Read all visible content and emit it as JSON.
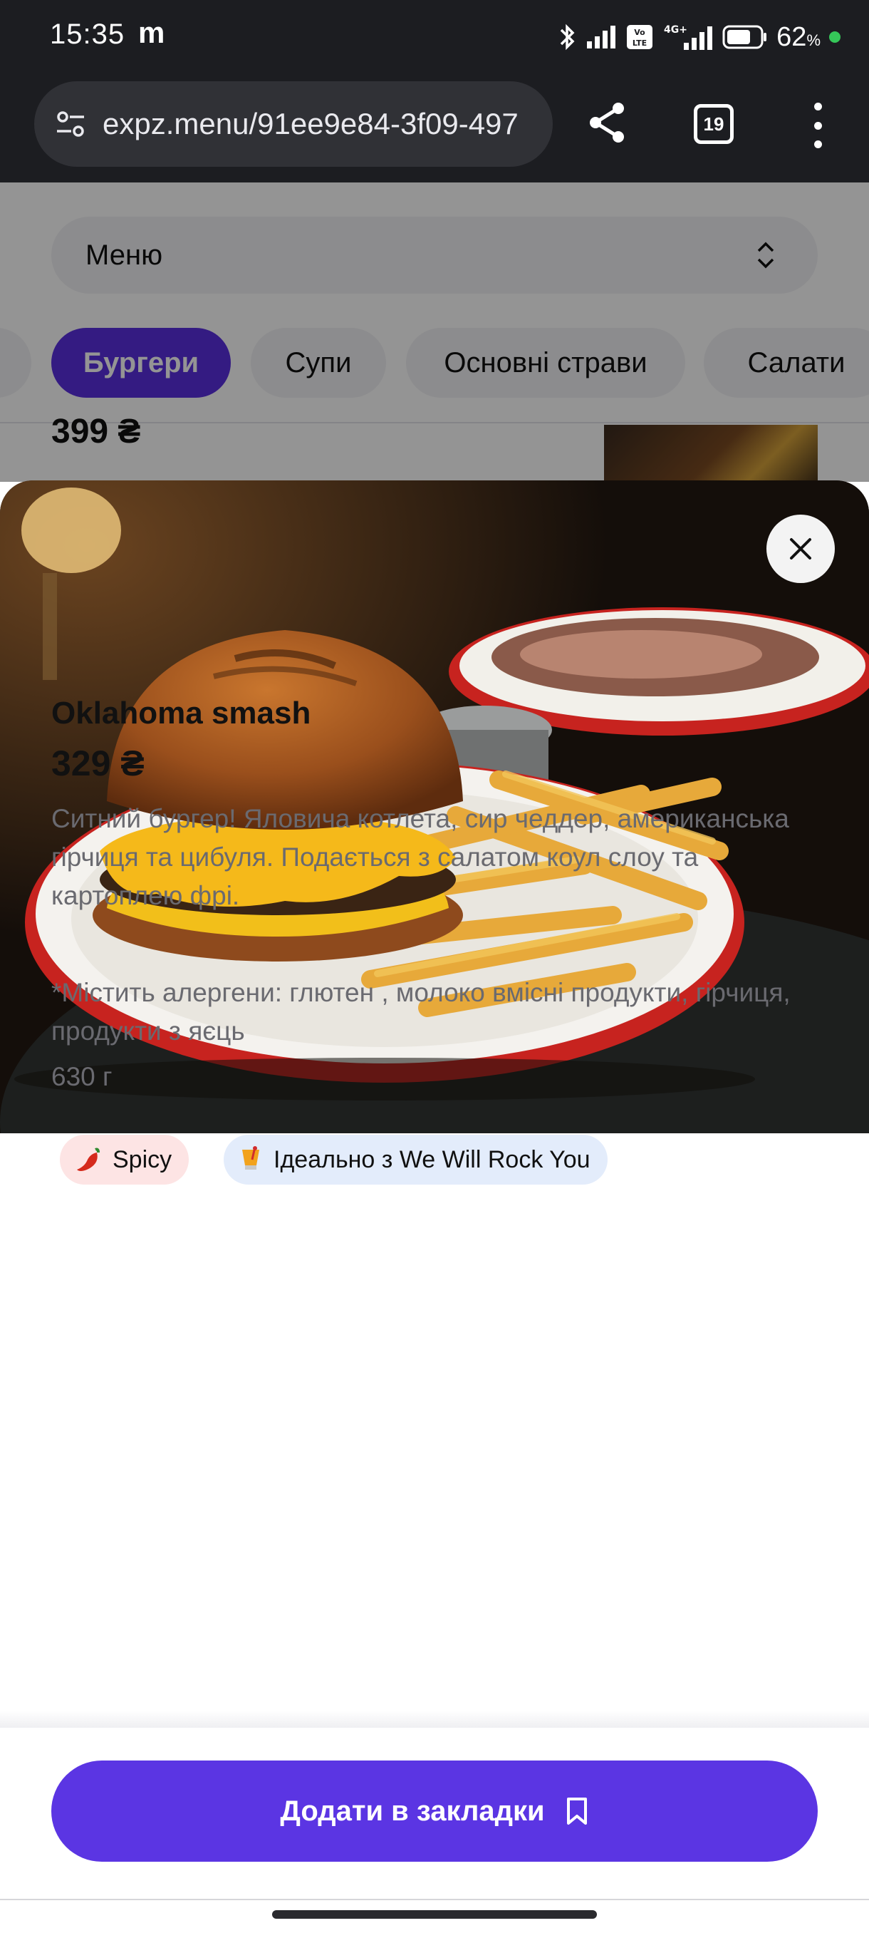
{
  "status_bar": {
    "time": "15:35",
    "notification_letter": "m",
    "battery": "62",
    "battery_unit": "%",
    "network": "4G+",
    "icons": [
      "bluetooth-icon",
      "signal-icon",
      "volte-icon",
      "signal-4g-icon",
      "battery-icon",
      "charging-dot-icon"
    ]
  },
  "browser": {
    "url": "expz.menu/91ee9e84-3f09-497",
    "tab_count": "19",
    "icons": [
      "site-settings-icon",
      "share-icon",
      "tabs-icon",
      "more-vert-icon"
    ]
  },
  "menu_header": {
    "select_label": "Меню",
    "categories": [
      {
        "label": "",
        "active": false
      },
      {
        "label": "Бургери",
        "active": true
      },
      {
        "label": "Супи",
        "active": false
      },
      {
        "label": "Основні страви",
        "active": false
      },
      {
        "label": "Салати",
        "active": false
      }
    ],
    "previous_item_price": "399 ₴"
  },
  "item": {
    "name": "Oklahoma smash",
    "price": "329 ₴",
    "description": "Ситний бургер! Яловича котлета, сир чеддер, американська гірчиця та цибуля. Подається з салатом коул слоу та картоплею фрі.",
    "allergens": "*Містить алергени: глютен , молоко вмісні продукти, гірчиця, продукти з яєць",
    "weight": "630 г",
    "tags": [
      {
        "label": "Spicy",
        "icon": "chili-pepper-icon",
        "color": "#fde4e4"
      },
      {
        "label": "Ідеально з We Will Rock You",
        "icon": "cocktail-icon",
        "color": "#e3ecfb"
      }
    ]
  },
  "actions": {
    "bookmark_label": "Додати в закладки"
  },
  "colors": {
    "accent": "#5b35e3",
    "chrome_bg": "#1c1d21"
  }
}
